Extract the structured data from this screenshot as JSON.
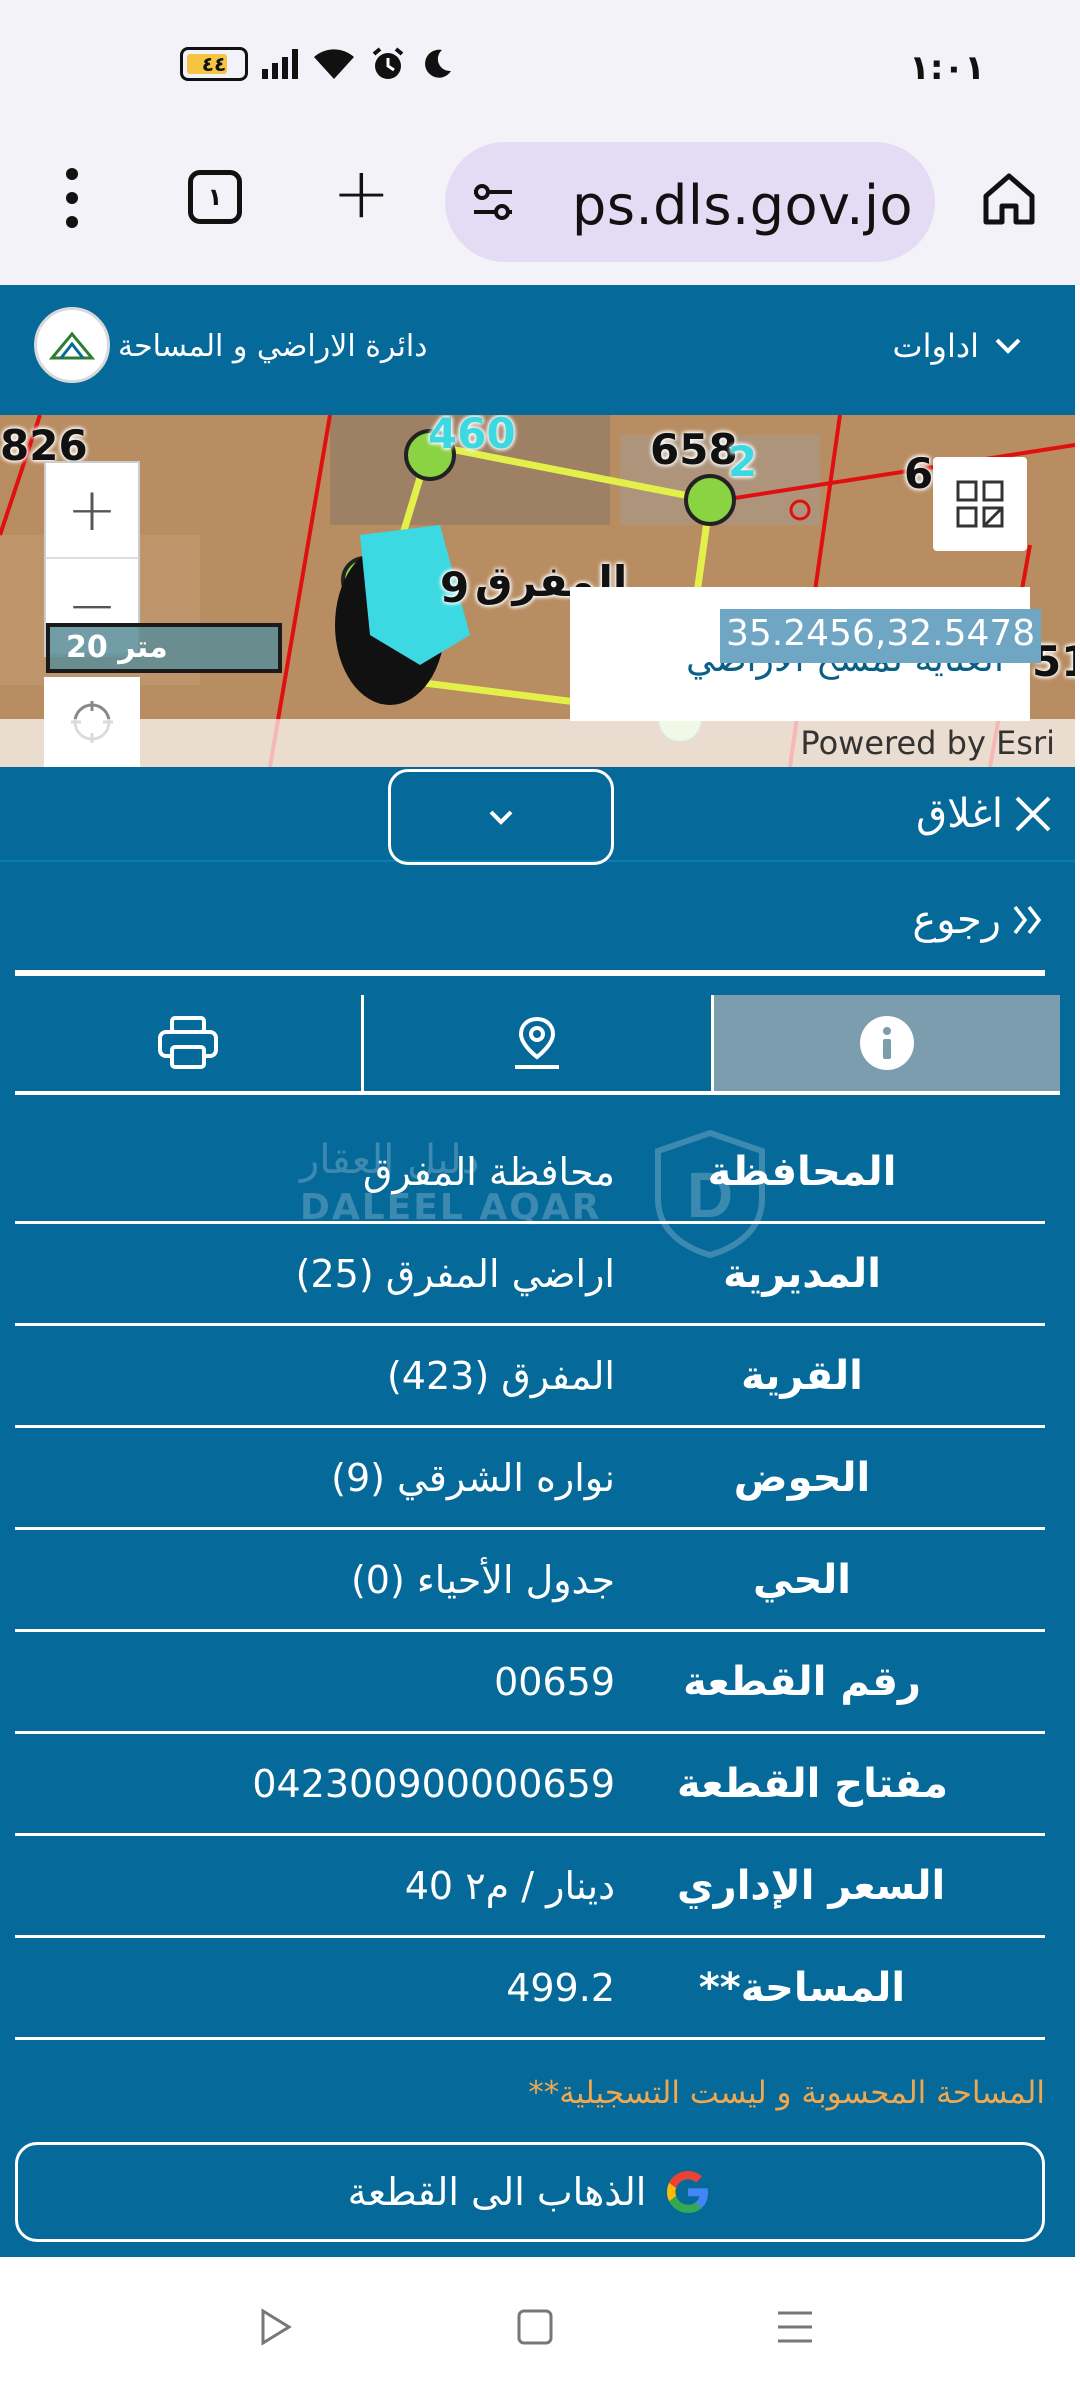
{
  "status_bar": {
    "time": "١:٠١",
    "battery": "٤٤"
  },
  "browser": {
    "tab_count": "١",
    "url": "ps.dls.gov.jo"
  },
  "app_header": {
    "title": "دائرة الاراضي و المساحة",
    "tools_label": "اداوات"
  },
  "map": {
    "parcel_labels": [
      "826",
      "460",
      "658",
      "2",
      "6",
      "9",
      "51",
      "المفرق"
    ],
    "scale_label": "20 متر",
    "coord_value": "35.2456,32.5478",
    "coord_label": "العناية لمسح الاراضي",
    "attribution": "Powered by Esri"
  },
  "panel": {
    "close_label": "اغلاق",
    "back_label": "رجوع",
    "tabs": [
      {
        "name": "info",
        "icon": "info-icon"
      },
      {
        "name": "location",
        "icon": "map-pin-icon"
      },
      {
        "name": "print",
        "icon": "printer-icon"
      }
    ],
    "rows": [
      {
        "key": "المحافظة",
        "value": "محافظة المفرق"
      },
      {
        "key": "المديرية",
        "value": "اراضي المفرق (25)"
      },
      {
        "key": "القرية",
        "value": "المفرق (423)"
      },
      {
        "key": "الحوض",
        "value": "نواره الشرقي (9)"
      },
      {
        "key": "الحي",
        "value": "جدول الأحياء (0)"
      },
      {
        "key": "رقم القطعة",
        "value": "00659"
      },
      {
        "key": "مفتاح القطعة",
        "value": "042300900000659"
      },
      {
        "key": "السعر الإداري",
        "value": "40 دينار / م٢"
      },
      {
        "key": "**المساحة",
        "value": "499.2"
      }
    ],
    "note": "**المساحة المحسوبة و ليست التسجيلية",
    "goto_label": "الذهاب الى القطعة",
    "watermark_ar": "دليل العقار",
    "watermark_en": "DALEEL AQAR"
  }
}
